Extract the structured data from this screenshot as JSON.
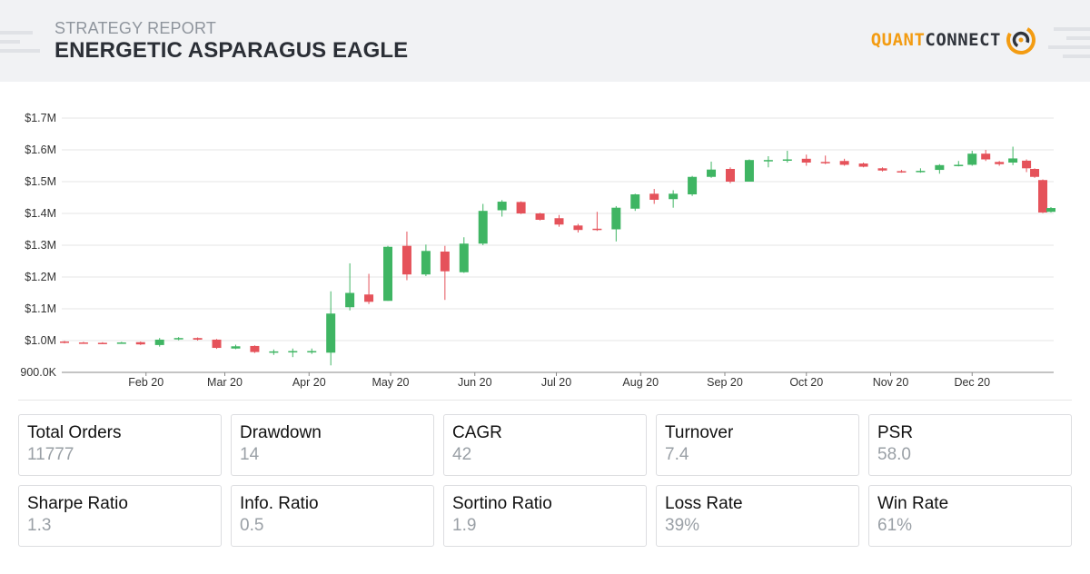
{
  "header": {
    "subtitle": "STRATEGY REPORT",
    "title": "ENERGETIC ASPARAGUS EAGLE",
    "brand_part1": "QUANT",
    "brand_part2": "CONNECT"
  },
  "colors": {
    "up": "#3fb563",
    "down": "#e5525a",
    "grid": "#e6e6e6",
    "accent": "#f39c12"
  },
  "chart_data": {
    "type": "candlestick",
    "title": "",
    "xlabel": "",
    "ylabel": "",
    "ylim": [
      900000,
      1700000
    ],
    "grid": "horizontal",
    "y_ticks": [
      {
        "value": 900000,
        "label": "900.0K"
      },
      {
        "value": 1000000,
        "label": "$1.0M"
      },
      {
        "value": 1100000,
        "label": "$1.1M"
      },
      {
        "value": 1200000,
        "label": "$1.2M"
      },
      {
        "value": 1300000,
        "label": "$1.3M"
      },
      {
        "value": 1400000,
        "label": "$1.4M"
      },
      {
        "value": 1500000,
        "label": "$1.5M"
      },
      {
        "value": 1600000,
        "label": "$1.6M"
      },
      {
        "value": 1700000,
        "label": "$1.7M"
      }
    ],
    "x_range": [
      "2020-01-01",
      "2020-12-31"
    ],
    "x_ticks": [
      {
        "date": "2020-02-01",
        "label": "Feb 20"
      },
      {
        "date": "2020-03-01",
        "label": "Mar 20"
      },
      {
        "date": "2020-04-01",
        "label": "Apr 20"
      },
      {
        "date": "2020-05-01",
        "label": "May 20"
      },
      {
        "date": "2020-06-01",
        "label": "Jun 20"
      },
      {
        "date": "2020-07-01",
        "label": "Jul 20"
      },
      {
        "date": "2020-08-01",
        "label": "Aug 20"
      },
      {
        "date": "2020-09-01",
        "label": "Sep 20"
      },
      {
        "date": "2020-10-01",
        "label": "Oct 20"
      },
      {
        "date": "2020-11-01",
        "label": "Nov 20"
      },
      {
        "date": "2020-12-01",
        "label": "Dec 20"
      }
    ],
    "candles": [
      {
        "date": "2020-01-02",
        "open": 997000,
        "close": 993000,
        "high": 999000,
        "low": 991000
      },
      {
        "date": "2020-01-09",
        "open": 994000,
        "close": 993000,
        "high": 996000,
        "low": 991000
      },
      {
        "date": "2020-01-16",
        "open": 993000,
        "close": 992000,
        "high": 995000,
        "low": 990000
      },
      {
        "date": "2020-01-23",
        "open": 992000,
        "close": 994000,
        "high": 996000,
        "low": 990000
      },
      {
        "date": "2020-01-30",
        "open": 995000,
        "close": 988000,
        "high": 997000,
        "low": 986000
      },
      {
        "date": "2020-02-06",
        "open": 986000,
        "close": 1003000,
        "high": 1008000,
        "low": 981000
      },
      {
        "date": "2020-02-13",
        "open": 1004000,
        "close": 1008000,
        "high": 1011000,
        "low": 1001000
      },
      {
        "date": "2020-02-20",
        "open": 1008000,
        "close": 1003000,
        "high": 1010000,
        "low": 1000000
      },
      {
        "date": "2020-02-27",
        "open": 1003000,
        "close": 977000,
        "high": 1005000,
        "low": 974000
      },
      {
        "date": "2020-03-05",
        "open": 975000,
        "close": 982000,
        "high": 987000,
        "low": 973000
      },
      {
        "date": "2020-03-12",
        "open": 983000,
        "close": 964000,
        "high": 985000,
        "low": 961000
      },
      {
        "date": "2020-03-19",
        "open": 962000,
        "close": 966000,
        "high": 972000,
        "low": 955000
      },
      {
        "date": "2020-03-26",
        "open": 965000,
        "close": 967000,
        "high": 975000,
        "low": 948000
      },
      {
        "date": "2020-04-02",
        "open": 963000,
        "close": 967000,
        "high": 975000,
        "low": 958000
      },
      {
        "date": "2020-04-09",
        "open": 962000,
        "close": 1085000,
        "high": 1155000,
        "low": 922000
      },
      {
        "date": "2020-04-16",
        "open": 1105000,
        "close": 1150000,
        "high": 1243000,
        "low": 1095000
      },
      {
        "date": "2020-04-23",
        "open": 1145000,
        "close": 1122000,
        "high": 1210000,
        "low": 1115000
      },
      {
        "date": "2020-04-30",
        "open": 1125000,
        "close": 1295000,
        "high": 1298000,
        "low": 1125000
      },
      {
        "date": "2020-05-07",
        "open": 1298000,
        "close": 1208000,
        "high": 1343000,
        "low": 1190000
      },
      {
        "date": "2020-05-14",
        "open": 1208000,
        "close": 1282000,
        "high": 1302000,
        "low": 1203000
      },
      {
        "date": "2020-05-21",
        "open": 1280000,
        "close": 1218000,
        "high": 1298000,
        "low": 1128000
      },
      {
        "date": "2020-05-28",
        "open": 1215000,
        "close": 1305000,
        "high": 1325000,
        "low": 1213000
      },
      {
        "date": "2020-06-04",
        "open": 1305000,
        "close": 1408000,
        "high": 1430000,
        "low": 1300000
      },
      {
        "date": "2020-06-11",
        "open": 1410000,
        "close": 1437000,
        "high": 1442000,
        "low": 1390000
      },
      {
        "date": "2020-06-18",
        "open": 1436000,
        "close": 1400000,
        "high": 1438000,
        "low": 1398000
      },
      {
        "date": "2020-06-25",
        "open": 1400000,
        "close": 1380000,
        "high": 1402000,
        "low": 1378000
      },
      {
        "date": "2020-07-02",
        "open": 1385000,
        "close": 1365000,
        "high": 1395000,
        "low": 1358000
      },
      {
        "date": "2020-07-09",
        "open": 1362000,
        "close": 1348000,
        "high": 1367000,
        "low": 1340000
      },
      {
        "date": "2020-07-16",
        "open": 1352000,
        "close": 1348000,
        "high": 1405000,
        "low": 1345000
      },
      {
        "date": "2020-07-23",
        "open": 1350000,
        "close": 1418000,
        "high": 1423000,
        "low": 1312000
      },
      {
        "date": "2020-07-30",
        "open": 1415000,
        "close": 1460000,
        "high": 1462000,
        "low": 1408000
      },
      {
        "date": "2020-08-06",
        "open": 1462000,
        "close": 1443000,
        "high": 1477000,
        "low": 1430000
      },
      {
        "date": "2020-08-13",
        "open": 1445000,
        "close": 1462000,
        "high": 1473000,
        "low": 1418000
      },
      {
        "date": "2020-08-20",
        "open": 1460000,
        "close": 1515000,
        "high": 1518000,
        "low": 1455000
      },
      {
        "date": "2020-08-27",
        "open": 1515000,
        "close": 1538000,
        "high": 1563000,
        "low": 1512000
      },
      {
        "date": "2020-09-03",
        "open": 1540000,
        "close": 1500000,
        "high": 1545000,
        "low": 1495000
      },
      {
        "date": "2020-09-10",
        "open": 1500000,
        "close": 1568000,
        "high": 1570000,
        "low": 1500000
      },
      {
        "date": "2020-09-17",
        "open": 1565000,
        "close": 1568000,
        "high": 1580000,
        "low": 1545000
      },
      {
        "date": "2020-09-24",
        "open": 1567000,
        "close": 1570000,
        "high": 1597000,
        "low": 1560000
      },
      {
        "date": "2020-10-01",
        "open": 1572000,
        "close": 1560000,
        "high": 1585000,
        "low": 1550000
      },
      {
        "date": "2020-10-08",
        "open": 1562000,
        "close": 1560000,
        "high": 1582000,
        "low": 1555000
      },
      {
        "date": "2020-10-15",
        "open": 1565000,
        "close": 1553000,
        "high": 1572000,
        "low": 1550000
      },
      {
        "date": "2020-10-22",
        "open": 1557000,
        "close": 1547000,
        "high": 1560000,
        "low": 1545000
      },
      {
        "date": "2020-10-29",
        "open": 1542000,
        "close": 1535000,
        "high": 1545000,
        "low": 1532000
      },
      {
        "date": "2020-11-05",
        "open": 1533000,
        "close": 1532000,
        "high": 1537000,
        "low": 1528000
      },
      {
        "date": "2020-11-12",
        "open": 1533000,
        "close": 1534000,
        "high": 1542000,
        "low": 1528000
      },
      {
        "date": "2020-11-19",
        "open": 1537000,
        "close": 1552000,
        "high": 1555000,
        "low": 1525000
      },
      {
        "date": "2020-11-26",
        "open": 1552000,
        "close": 1553000,
        "high": 1565000,
        "low": 1548000
      },
      {
        "date": "2020-12-01",
        "open": 1553000,
        "close": 1588000,
        "high": 1597000,
        "low": 1550000
      },
      {
        "date": "2020-12-06",
        "open": 1588000,
        "close": 1570000,
        "high": 1600000,
        "low": 1565000
      },
      {
        "date": "2020-12-11",
        "open": 1562000,
        "close": 1555000,
        "high": 1565000,
        "low": 1550000
      },
      {
        "date": "2020-12-16",
        "open": 1560000,
        "close": 1573000,
        "high": 1610000,
        "low": 1552000
      },
      {
        "date": "2020-12-21",
        "open": 1566000,
        "close": 1542000,
        "high": 1570000,
        "low": 1530000
      },
      {
        "date": "2020-12-24",
        "open": 1540000,
        "close": 1515000,
        "high": 1542000,
        "low": 1512000
      },
      {
        "date": "2020-12-27",
        "open": 1505000,
        "close": 1403000,
        "high": 1507000,
        "low": 1401000
      },
      {
        "date": "2020-12-30",
        "open": 1405000,
        "close": 1417000,
        "high": 1420000,
        "low": 1403000
      }
    ]
  },
  "stats": [
    {
      "label": "Total Orders",
      "value": "11777"
    },
    {
      "label": "Drawdown",
      "value": "14"
    },
    {
      "label": "CAGR",
      "value": "42"
    },
    {
      "label": "Turnover",
      "value": "7.4"
    },
    {
      "label": "PSR",
      "value": "58.0"
    },
    {
      "label": "Sharpe Ratio",
      "value": "1.3"
    },
    {
      "label": "Info. Ratio",
      "value": "0.5"
    },
    {
      "label": "Sortino Ratio",
      "value": "1.9"
    },
    {
      "label": "Loss Rate",
      "value": "39%"
    },
    {
      "label": "Win Rate",
      "value": "61%"
    }
  ]
}
